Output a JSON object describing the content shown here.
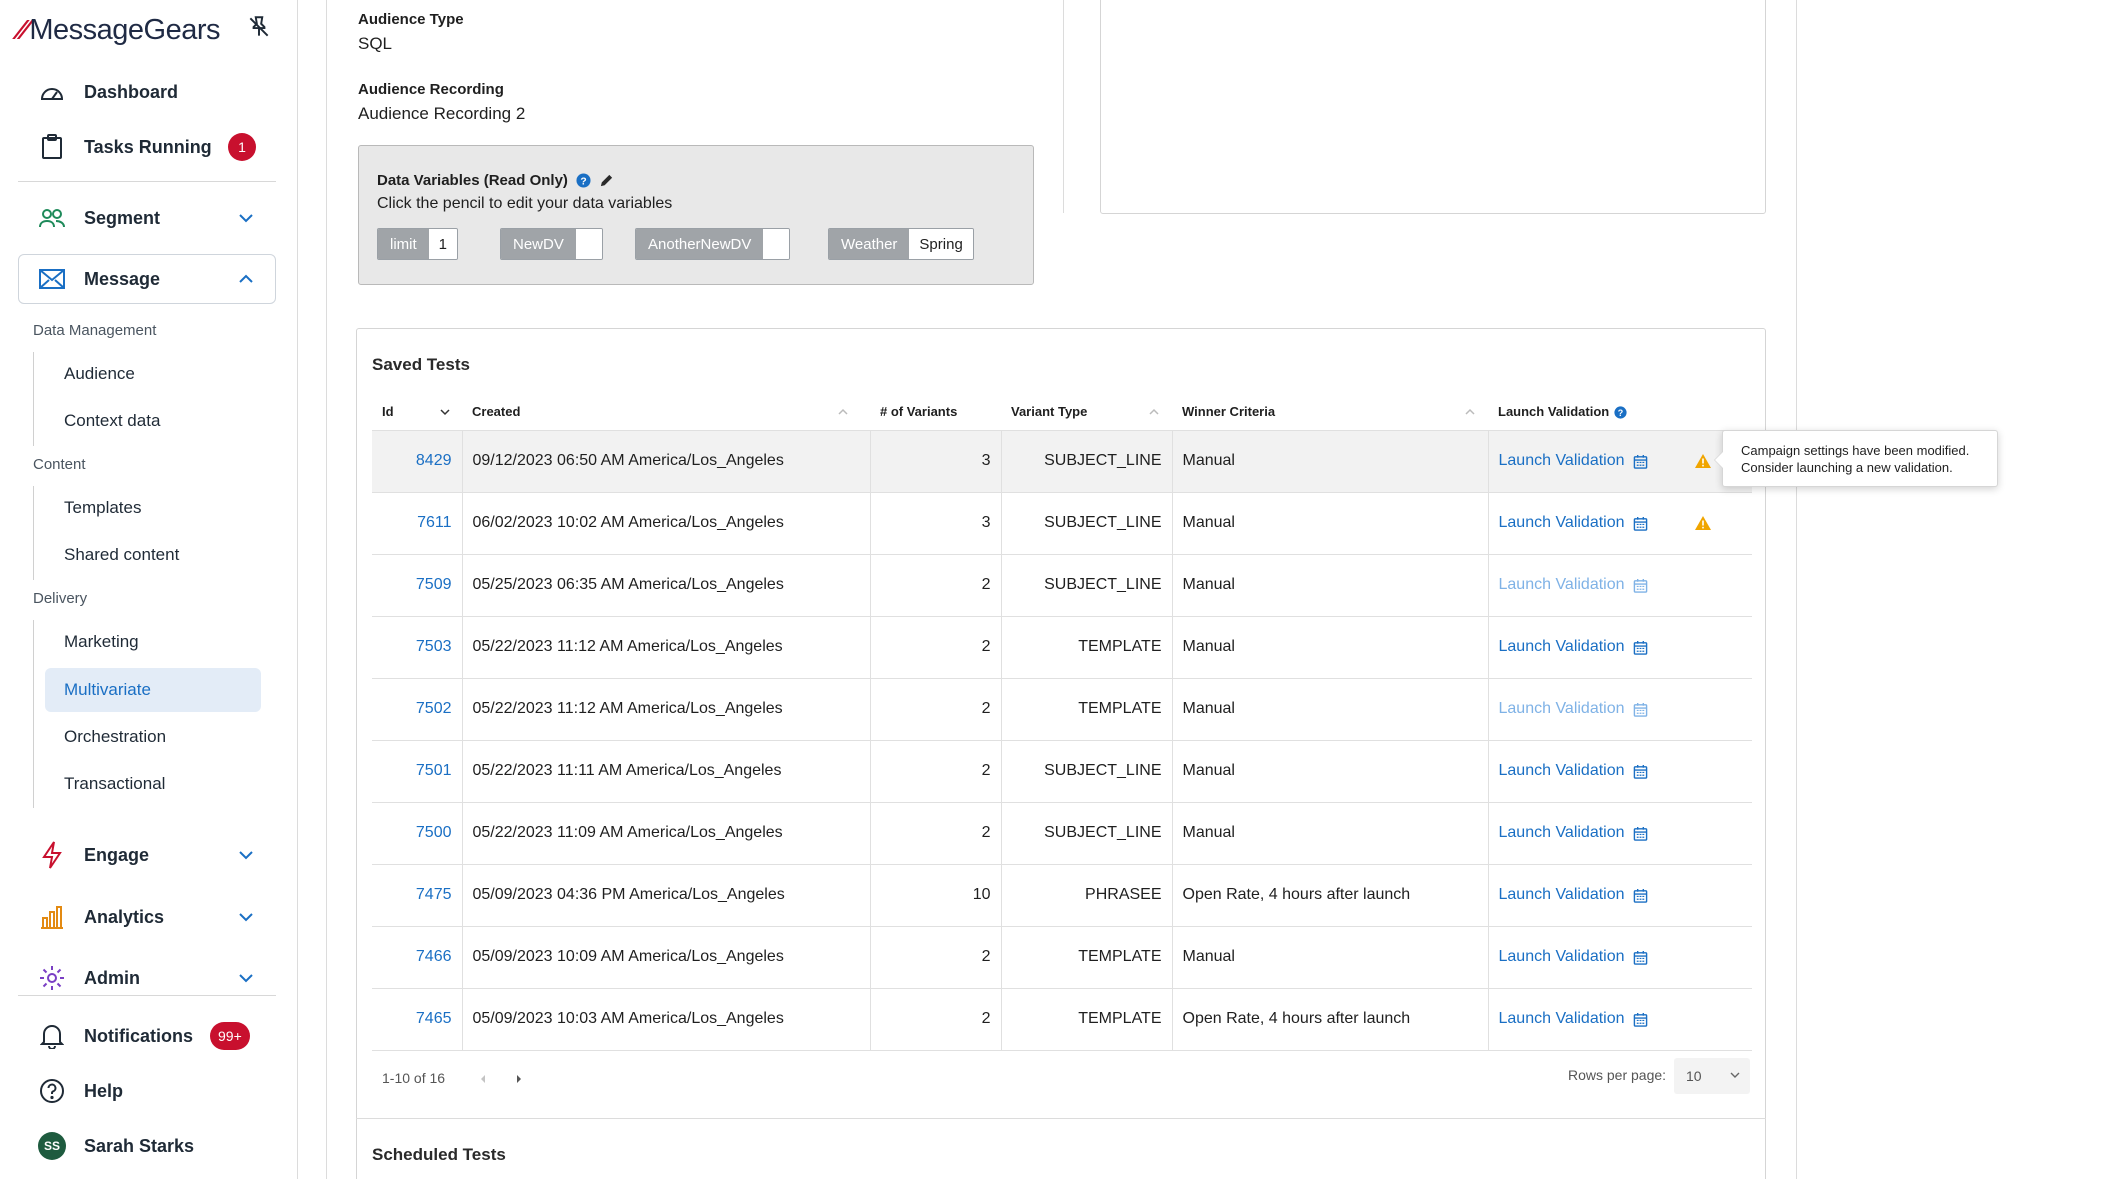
{
  "brand": {
    "name": "MessageGears"
  },
  "nav": {
    "dashboard": "Dashboard",
    "tasks_running": "Tasks Running",
    "tasks_badge": "1",
    "segment": "Segment",
    "message": "Message",
    "data_management": "Data Management",
    "audience": "Audience",
    "context_data": "Context data",
    "content": "Content",
    "templates": "Templates",
    "shared_content": "Shared content",
    "delivery": "Delivery",
    "marketing": "Marketing",
    "multivariate": "Multivariate",
    "orchestration": "Orchestration",
    "transactional": "Transactional",
    "engage": "Engage",
    "analytics": "Analytics",
    "admin": "Admin",
    "notifications": "Notifications",
    "notifications_badge": "99+",
    "help": "Help",
    "user_name": "Sarah Starks",
    "user_initials": "SS"
  },
  "details": {
    "audience_type_label": "Audience Type",
    "audience_type_value": "SQL",
    "audience_recording_label": "Audience Recording",
    "audience_recording_value": "Audience Recording 2"
  },
  "data_variables": {
    "title": "Data Variables (Read Only)",
    "subtitle": "Click the pencil to edit your data variables",
    "items": [
      {
        "key": "limit",
        "value": "1"
      },
      {
        "key": "NewDV",
        "value": ""
      },
      {
        "key": "AnotherNewDV",
        "value": ""
      },
      {
        "key": "Weather",
        "value": "Spring"
      }
    ]
  },
  "saved_tests": {
    "title": "Saved Tests",
    "columns": [
      "Id",
      "Created",
      "# of Variants",
      "Variant Type",
      "Winner Criteria",
      "Launch Validation"
    ],
    "launch_label": "Launch Validation",
    "rows": [
      {
        "id": "8429",
        "created": "09/12/2023 06:50 AM America/Los_Angeles",
        "variants": "3",
        "type": "SUBJECT_LINE",
        "criteria": "Manual",
        "disabled": false,
        "warning": true
      },
      {
        "id": "7611",
        "created": "06/02/2023 10:02 AM America/Los_Angeles",
        "variants": "3",
        "type": "SUBJECT_LINE",
        "criteria": "Manual",
        "disabled": false,
        "warning": true
      },
      {
        "id": "7509",
        "created": "05/25/2023 06:35 AM America/Los_Angeles",
        "variants": "2",
        "type": "SUBJECT_LINE",
        "criteria": "Manual",
        "disabled": true,
        "warning": false
      },
      {
        "id": "7503",
        "created": "05/22/2023 11:12 AM America/Los_Angeles",
        "variants": "2",
        "type": "TEMPLATE",
        "criteria": "Manual",
        "disabled": false,
        "warning": false
      },
      {
        "id": "7502",
        "created": "05/22/2023 11:12 AM America/Los_Angeles",
        "variants": "2",
        "type": "TEMPLATE",
        "criteria": "Manual",
        "disabled": true,
        "warning": false
      },
      {
        "id": "7501",
        "created": "05/22/2023 11:11 AM America/Los_Angeles",
        "variants": "2",
        "type": "SUBJECT_LINE",
        "criteria": "Manual",
        "disabled": false,
        "warning": false
      },
      {
        "id": "7500",
        "created": "05/22/2023 11:09 AM America/Los_Angeles",
        "variants": "2",
        "type": "SUBJECT_LINE",
        "criteria": "Manual",
        "disabled": false,
        "warning": false
      },
      {
        "id": "7475",
        "created": "05/09/2023 04:36 PM America/Los_Angeles",
        "variants": "10",
        "type": "PHRASEE",
        "criteria": "Open Rate, 4 hours after launch",
        "disabled": false,
        "warning": false
      },
      {
        "id": "7466",
        "created": "05/09/2023 10:09 AM America/Los_Angeles",
        "variants": "2",
        "type": "TEMPLATE",
        "criteria": "Manual",
        "disabled": false,
        "warning": false
      },
      {
        "id": "7465",
        "created": "05/09/2023 10:03 AM America/Los_Angeles",
        "variants": "2",
        "type": "TEMPLATE",
        "criteria": "Open Rate, 4 hours after launch",
        "disabled": false,
        "warning": false
      }
    ],
    "tooltip_line1": "Campaign settings have been modified.",
    "tooltip_line2": "Consider launching a new validation.",
    "pagination": "1-10 of 16",
    "rows_per_page_label": "Rows per page:",
    "rows_per_page_value": "10"
  },
  "scheduled_tests": {
    "title": "Scheduled Tests"
  },
  "colors": {
    "accent": "#1a6fc4",
    "brand_red": "#c8102e",
    "warning": "#f0a500"
  }
}
